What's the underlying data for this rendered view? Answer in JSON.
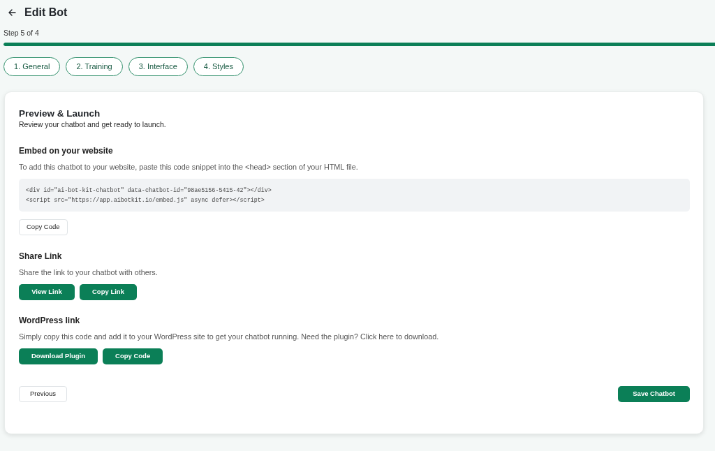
{
  "header": {
    "title": "Edit Bot"
  },
  "progress": {
    "label": "Step 5 of 4",
    "level": 1
  },
  "tabs": [
    {
      "label": "1. General",
      "selected": false
    },
    {
      "label": "2. Training",
      "selected": false
    },
    {
      "label": "3. Interface",
      "selected": false
    },
    {
      "label": "4. Styles",
      "selected": false
    }
  ],
  "card": {
    "title": "Preview & Launch",
    "subtitle": "Review your chatbot and get ready to launch.",
    "sections": [
      {
        "heading": "Embed on your website",
        "description": "To add this chatbot to your website, paste this code snippet into the <head> section of your HTML file.",
        "code_lines": [
          "<div id=\"ai-bot-kit-chatbot\" data-chatbot-id=\"98ae5156-5415-42\"></div>",
          "<script src=\"https://app.aibotkit.io/embed.js\" async defer></script>"
        ],
        "buttons": [
          {
            "label": "Copy Code",
            "kind": "outline"
          }
        ]
      },
      {
        "heading": "Share Link",
        "description": "Share the link to your chatbot with others.",
        "buttons": [
          {
            "label": "View Link",
            "kind": "primary"
          },
          {
            "label": "Copy Link",
            "kind": "primary"
          }
        ]
      },
      {
        "heading": "WordPress link",
        "description": "Simply copy this code and add it to your WordPress site to get your chatbot running. Need the plugin? Click here to download.",
        "buttons": [
          {
            "label": "Download Plugin",
            "kind": "primary"
          },
          {
            "label": "Copy Code",
            "kind": "primary"
          }
        ]
      }
    ],
    "footer": {
      "buttons": [
        {
          "label": "Previous",
          "kind": "outline"
        },
        {
          "label": "Save Chatbot",
          "kind": "primary"
        }
      ]
    }
  }
}
